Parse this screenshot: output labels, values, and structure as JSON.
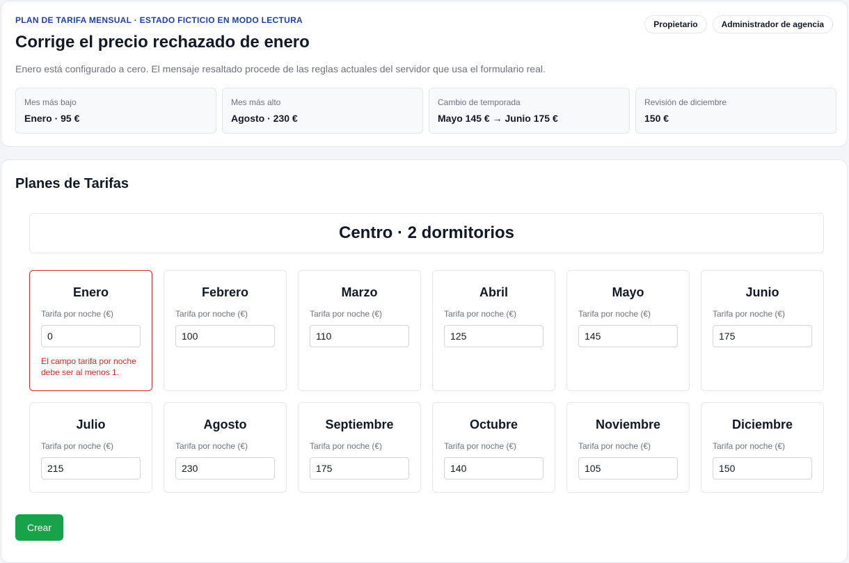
{
  "header": {
    "eyebrow": "PLAN DE TARIFA MENSUAL · ESTADO FICTICIO EN MODO LECTURA",
    "title": "Corrige el precio rechazado de enero",
    "subtitle": "Enero está configurado a cero. El mensaje resaltado procede de las reglas actuales del servidor que usa el formulario real.",
    "roles": [
      "Propietario",
      "Administrador de agencia"
    ]
  },
  "stats": [
    {
      "label": "Mes más bajo",
      "value": "Enero · 95 €"
    },
    {
      "label": "Mes más alto",
      "value": "Agosto · 230 €"
    },
    {
      "label": "Cambio de temporada",
      "value": "Mayo 145 € → Junio 175 €"
    },
    {
      "label": "Revisión de diciembre",
      "value": "150 €"
    }
  ],
  "plans": {
    "section_title": "Planes de Tarifas",
    "property_title": "Centro · 2 dormitorios",
    "rate_label": "Tarifa por noche (€)",
    "months": [
      {
        "name": "Enero",
        "value": "0",
        "error": "El campo tarifa por noche debe ser al menos 1."
      },
      {
        "name": "Febrero",
        "value": "100"
      },
      {
        "name": "Marzo",
        "value": "110"
      },
      {
        "name": "Abril",
        "value": "125"
      },
      {
        "name": "Mayo",
        "value": "145"
      },
      {
        "name": "Junio",
        "value": "175"
      },
      {
        "name": "Julio",
        "value": "215"
      },
      {
        "name": "Agosto",
        "value": "230"
      },
      {
        "name": "Septiembre",
        "value": "175"
      },
      {
        "name": "Octubre",
        "value": "140"
      },
      {
        "name": "Noviembre",
        "value": "105"
      },
      {
        "name": "Diciembre",
        "value": "150"
      }
    ],
    "create_label": "Crear"
  },
  "colors": {
    "accent": "#1e40af",
    "error": "#dc2626",
    "create_button": "#16a34a"
  }
}
